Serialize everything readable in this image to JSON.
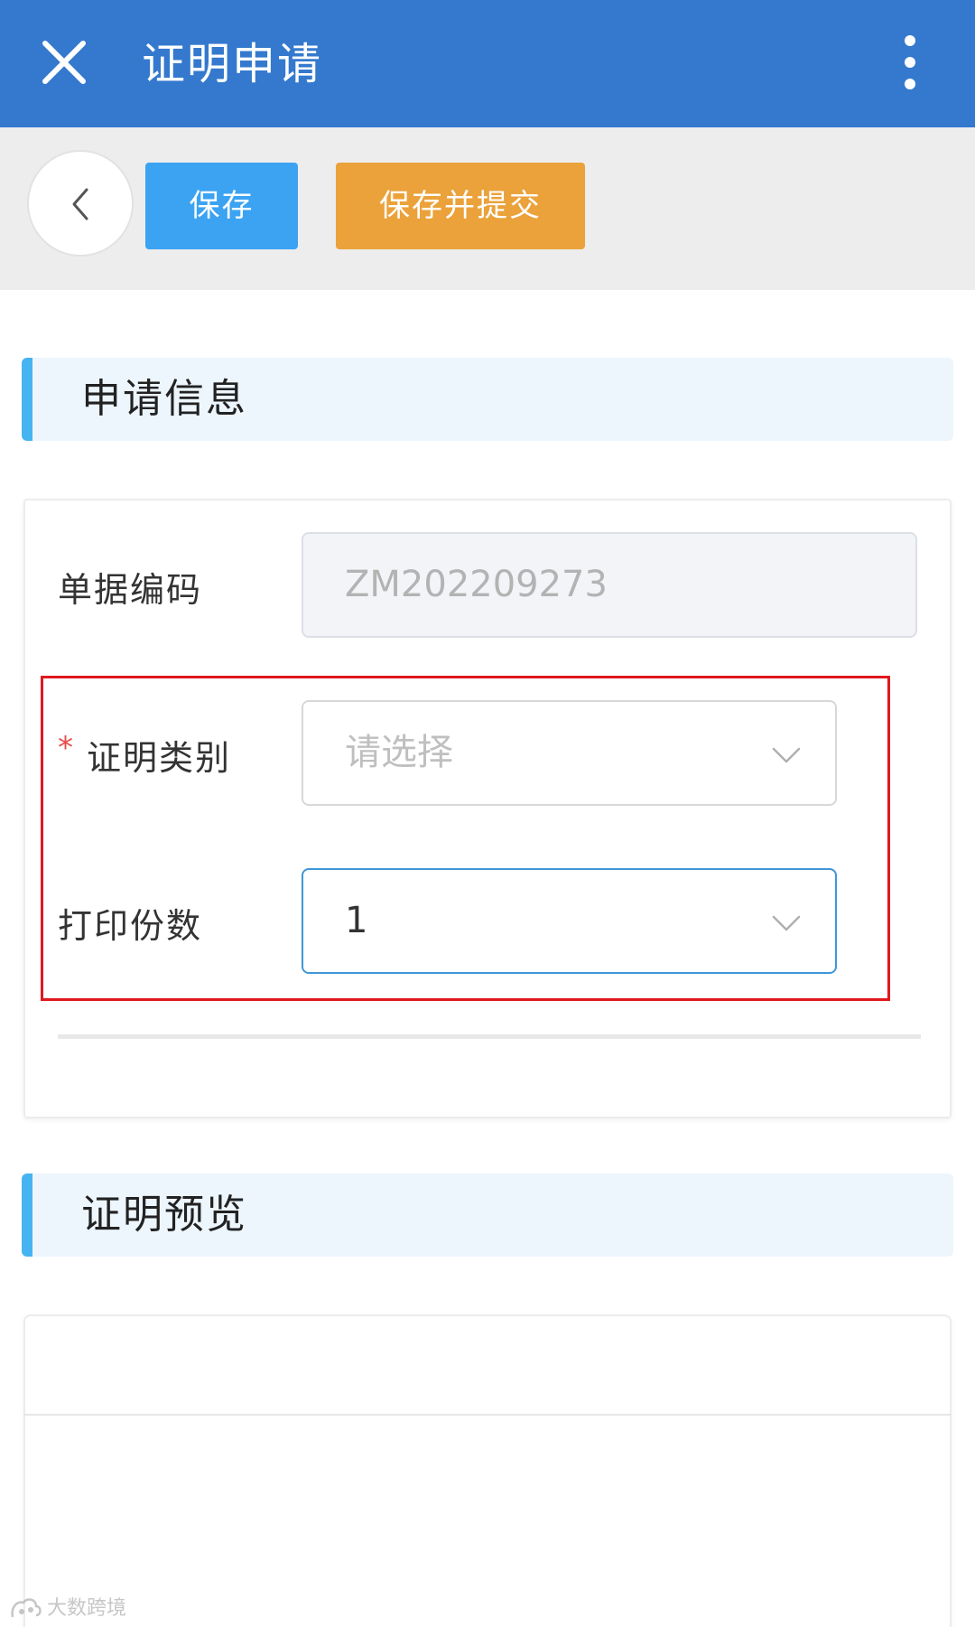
{
  "header": {
    "title": "证明申请",
    "bg_color": "#3479ce",
    "close_icon": "close-icon",
    "more_icon": "more-vertical-icon"
  },
  "toolbar": {
    "back_icon": "chevron-left-icon",
    "save_label": "保存",
    "save_submit_label": "保存并提交",
    "save_color": "#3ba3f2",
    "submit_color": "#eba23a"
  },
  "sections": {
    "apply_info": "申请信息",
    "preview": "证明预览"
  },
  "form": {
    "doc_code_label": "单据编码",
    "doc_code_value": "ZM202209273",
    "cert_type_required": "*",
    "cert_type_label": "证明类别",
    "cert_type_placeholder": "请选择",
    "print_copies_label": "打印份数",
    "print_copies_value": "1"
  },
  "watermark": {
    "text": "大数跨境"
  }
}
